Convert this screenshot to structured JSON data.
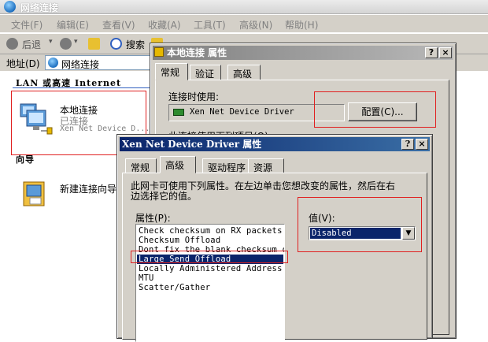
{
  "explorer": {
    "title": "网络连接",
    "menu": [
      "文件(F)",
      "编辑(E)",
      "查看(V)",
      "收藏(A)",
      "工具(T)",
      "高级(N)",
      "帮助(H)"
    ],
    "toolbar": {
      "back": "后退",
      "search": "搜索",
      "folders_partial": "文件夹"
    },
    "address_label": "地址(D)",
    "address_value": "网络连接",
    "section_lan": "LAN 或高速 Internet",
    "connection_name": "本地连接",
    "connection_status": "已连接",
    "connection_device": "Xen Net Device D...",
    "section_wizard": "向导",
    "wizard_item": "新建连接向导"
  },
  "local_conn_dialog": {
    "title": "本地连接 属性",
    "tabs": [
      "常规",
      "验证",
      "高级"
    ],
    "connect_using_label": "连接时使用:",
    "device_name": "Xen Net Device Driver",
    "configure_button": "配置(C)...",
    "partial_text": "此连接使用下列项目(O):"
  },
  "driver_dialog": {
    "title": "Xen Net Device Driver 属性",
    "tabs": [
      "常规",
      "高级",
      "驱动程序",
      "资源"
    ],
    "description": "此网卡可使用下列属性。在左边单击您想改变的属性，然后在右边选择它的值。",
    "property_label": "属性(P):",
    "value_label": "值(V):",
    "properties": [
      "Check checksum on RX packets",
      "Checksum Offload",
      "Dont fix the blank checksum on",
      "Large Send Offload",
      "Locally Administered Address",
      "MTU",
      "Scatter/Gather"
    ],
    "selected_index": 3,
    "value_selected": "Disabled"
  },
  "colors": {
    "highlight": "#0a246a",
    "title_active": "#0a246a",
    "title_inactive": "#808080",
    "annotation_red": "#e02020"
  }
}
